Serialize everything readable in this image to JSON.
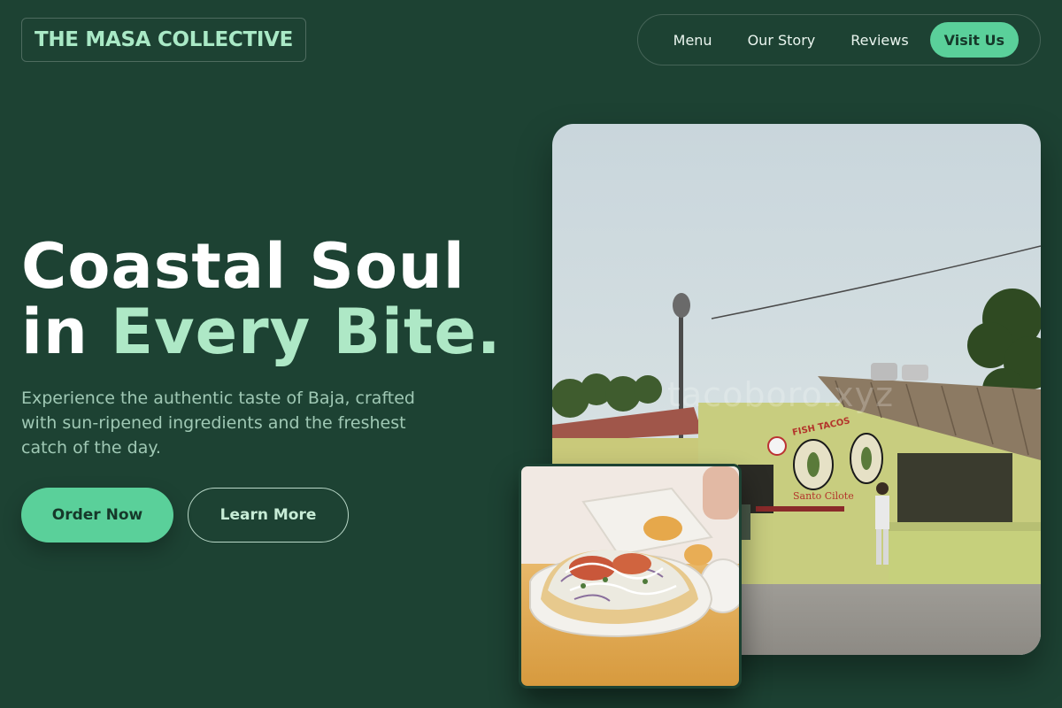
{
  "header": {
    "logo": "THE MASA COLLECTIVE",
    "nav": [
      {
        "label": "Menu"
      },
      {
        "label": "Our Story"
      },
      {
        "label": "Reviews"
      }
    ],
    "cta": "Visit Us"
  },
  "hero": {
    "headline_line1": "Coastal Soul",
    "headline_line2_prefix": "in ",
    "headline_line2_accent": "Every Bite.",
    "subtext": "Experience the authentic taste of Baja, crafted with sun-ripened ingredients and the freshest catch of the day.",
    "primary_button": "Order Now",
    "secondary_button": "Learn More"
  },
  "images": {
    "main_watermark": "tacoboro.xyz",
    "sign_text_1": "FISH TACOS",
    "sign_text_2": "Santo Cilote"
  },
  "colors": {
    "background": "#1d4233",
    "accent": "#5ad09a",
    "accent_text": "#aee8c6"
  }
}
